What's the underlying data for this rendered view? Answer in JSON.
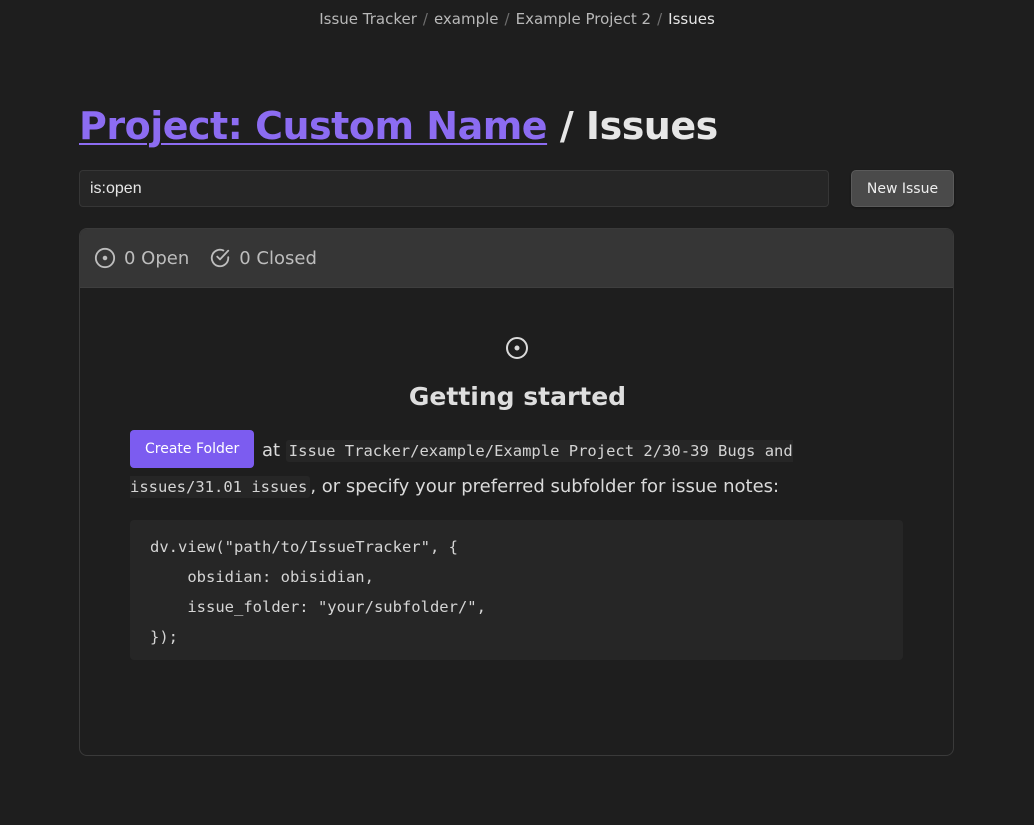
{
  "breadcrumb": {
    "items": [
      "Issue Tracker",
      "example",
      "Example Project 2"
    ],
    "current": "Issues",
    "separator": "/"
  },
  "header": {
    "project_link": "Project: Custom Name",
    "suffix": " / Issues"
  },
  "search": {
    "value": "is:open",
    "placeholder": ""
  },
  "toolbar": {
    "new_issue_label": "New Issue"
  },
  "filters": {
    "open_label": "0 Open",
    "closed_label": "0 Closed",
    "open_icon": "issue-opened-icon",
    "closed_icon": "check-circle-icon"
  },
  "empty_state": {
    "icon": "issue-opened-icon",
    "title": "Getting started",
    "create_folder_label": "Create Folder",
    "text_at": "at",
    "folder_path": "Issue Tracker/example/Example Project 2/30-39 Bugs and issues/31.01 issues",
    "text_tail": ", or specify your preferred subfolder for issue notes:",
    "code": "dv.view(\"path/to/IssueTracker\", {\n    obsidian: obisidian,\n    issue_folder: \"your/subfolder/\",\n});"
  },
  "colors": {
    "accent": "#7c5cf0",
    "link": "#8c6cf2",
    "background": "#1e1e1e",
    "panel_header": "#363636"
  }
}
